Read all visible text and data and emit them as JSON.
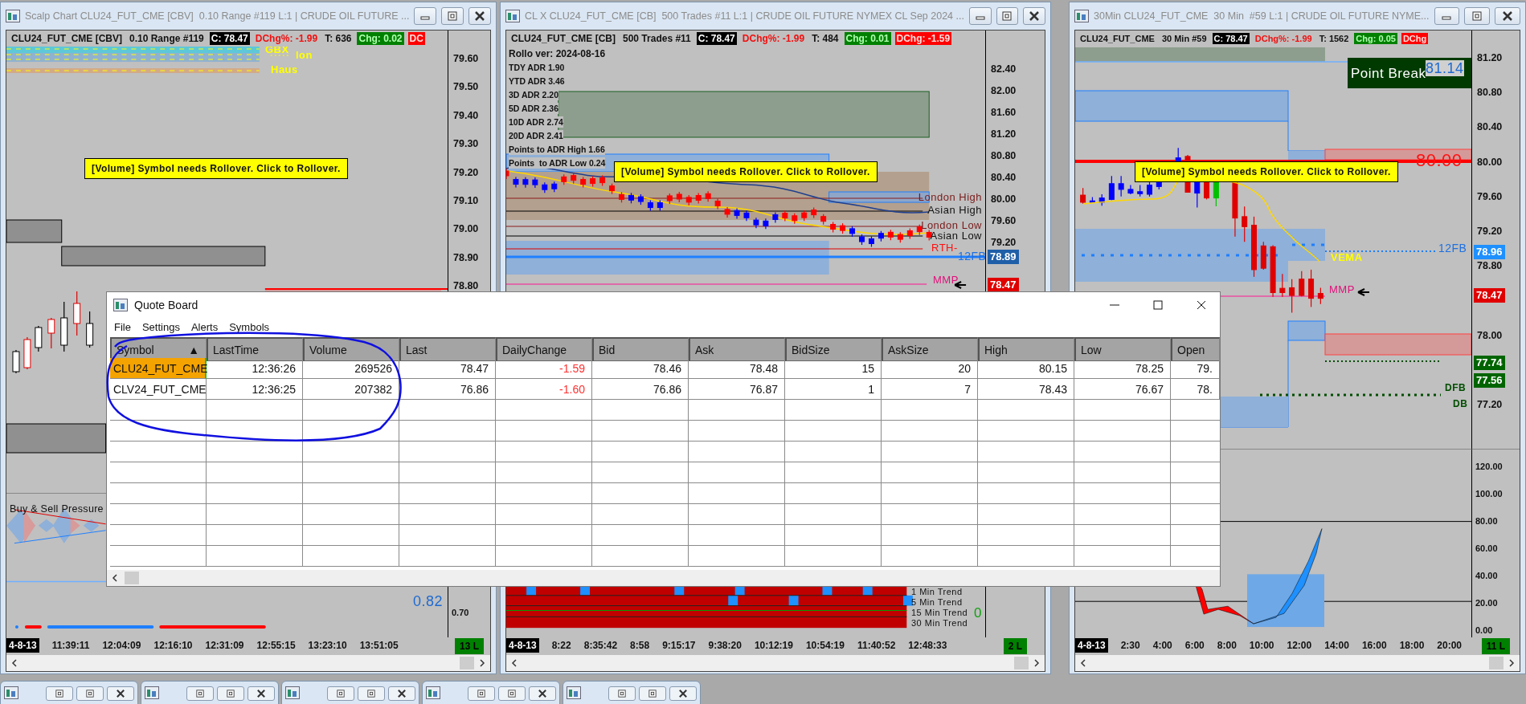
{
  "chart_windows": [
    {
      "kind": "range",
      "title": "Scalp Chart CLU24_FUT_CME [CBV]  0.10 Range #119 L:1 | CRUDE OIL FUTURE ...",
      "header": [
        {
          "kind": "plain",
          "text": "CLU24_FUT_CME [CBV]"
        },
        {
          "kind": "plain",
          "text": "0.10 Range #119"
        },
        {
          "kind": "close",
          "text": "C: 78.47"
        },
        {
          "kind": "down",
          "text": "DChg%: -1.99"
        },
        {
          "kind": "plain",
          "text": "T: 636"
        },
        {
          "kind": "up_box",
          "text": "Chg: 0.02"
        },
        {
          "kind": "down_box",
          "text": "DC"
        }
      ],
      "notice": "[Volume] Symbol needs Rollover. Click to Rollover.",
      "labels": [
        {
          "kind": "yellow",
          "text": "GBX"
        },
        {
          "kind": "yellow",
          "text": "lon"
        },
        {
          "kind": "yellow",
          "text": "Haus"
        }
      ],
      "price_ticks": [
        "79.60",
        "79.50",
        "79.40",
        "79.30",
        "79.20",
        "79.10",
        "79.00",
        "78.90",
        "78.80"
      ],
      "lower": {
        "labels": [
          {
            "kind": "title",
            "text": "Buy & Sell Pressure"
          },
          {
            "kind": "lightblue",
            "text": "0.82"
          }
        ],
        "ticks": [
          "0.70"
        ]
      },
      "time_start": "4-8-13",
      "time_ticks": [
        "11:39:11",
        "12:04:09",
        "12:16:10",
        "12:31:09",
        "12:55:15",
        "13:23:10",
        "13:51:05"
      ],
      "bar_count": "13 L"
    },
    {
      "kind": "trades",
      "title": "CL X CLU24_FUT_CME [CB]  500 Trades #11 L:1 | CRUDE OIL FUTURE NYMEX CL Sep 2024 ...",
      "header": [
        {
          "kind": "plain",
          "text": "CLU24_FUT_CME [CB]"
        },
        {
          "kind": "plain",
          "text": "500 Trades #11"
        },
        {
          "kind": "close",
          "text": "C: 78.47"
        },
        {
          "kind": "down",
          "text": "DChg%: -1.99"
        },
        {
          "kind": "plain",
          "text": "T: 484"
        },
        {
          "kind": "up_box",
          "text": "Chg: 0.01"
        },
        {
          "kind": "down_box",
          "text": "DChg: -1.59"
        }
      ],
      "notice": "[Volume] Symbol needs Rollover. Click to Rollover.",
      "stats": [
        "Rollo ver: 2024-08-16",
        "TDY ADR 1.90",
        "YTD ADR 3.46",
        "3D ADR 2.20",
        "5D ADR 2.36",
        "10D ADR 2.74",
        "20D ADR 2.41",
        "Points to ADR High 1.66",
        "Points  to ADR Low 0.24"
      ],
      "labels": [
        {
          "kind": "darkred",
          "text": "London High"
        },
        {
          "kind": "black",
          "text": "Asian High"
        },
        {
          "kind": "darkred",
          "text": "London Low"
        },
        {
          "kind": "black",
          "text": "Asian Low"
        },
        {
          "kind": "red",
          "text": "RTH-"
        },
        {
          "kind": "blue",
          "text": "12FB"
        },
        {
          "kind": "magenta",
          "text": "MMP"
        }
      ],
      "price_ticks": [
        "82.40",
        "82.00",
        "81.60",
        "81.20",
        "80.80",
        "80.40",
        "80.00",
        "79.60",
        "79.20"
      ],
      "price_badges": [
        {
          "text": "78.89",
          "color": "#1f5fa8"
        },
        {
          "text": "78.47",
          "color": "#e00000"
        }
      ],
      "lower": {
        "labels": [
          {
            "kind": "black",
            "text": "1 Min Trend"
          },
          {
            "kind": "black",
            "text": "5 Min Trend"
          },
          {
            "kind": "black",
            "text": "15 Min Trend"
          },
          {
            "kind": "black",
            "text": "30 Min Trend"
          },
          {
            "kind": "green",
            "text": "0"
          }
        ]
      },
      "time_start": "4-8-13",
      "time_ticks": [
        "8:22",
        "8:35:42",
        "8:58",
        "9:15:17",
        "9:38:20",
        "10:12:19",
        "10:54:19",
        "11:40:52",
        "12:48:33"
      ],
      "bar_count": "2 L"
    },
    {
      "kind": "time",
      "title": "30Min CLU24_FUT_CME  30 Min  #59 L:1 | CRUDE OIL FUTURE NYME...",
      "header": [
        {
          "kind": "plain",
          "text": "CLU24_FUT_CME"
        },
        {
          "kind": "plain",
          "text": "30 Min  #59"
        },
        {
          "kind": "close",
          "text": "C: 78.47"
        },
        {
          "kind": "down",
          "text": "DChg%: -1.99"
        },
        {
          "kind": "plain",
          "text": "T: 1562"
        },
        {
          "kind": "up_box",
          "text": "Chg: 0.05"
        },
        {
          "kind": "down_box",
          "text": "DChg"
        }
      ],
      "notice": "[Volume] Symbol needs Rollover. Click to Rollover.",
      "labels": [
        {
          "kind": "point_break",
          "text": "Point Break"
        },
        {
          "kind": "lightblue",
          "text": "81.14"
        },
        {
          "kind": "redlarge",
          "text": "80.00"
        },
        {
          "kind": "blue",
          "text": "12FB"
        },
        {
          "kind": "yellow",
          "text": "VEMA"
        },
        {
          "kind": "magenta",
          "text": "MMP"
        },
        {
          "kind": "darkgreen",
          "text": "DFB"
        },
        {
          "kind": "darkgreen",
          "text": "DB"
        }
      ],
      "price_ticks": [
        "81.20",
        "80.80",
        "80.40",
        "80.00",
        "79.60",
        "79.20",
        "78.80",
        "78.00",
        "77.20"
      ],
      "price_badges": [
        {
          "text": "78.96",
          "color": "#1e90ff"
        },
        {
          "text": "78.47",
          "color": "#e00000"
        },
        {
          "text": "77.74",
          "color": "#006400"
        },
        {
          "text": "77.56",
          "color": "#006400"
        }
      ],
      "lower": {
        "ticks": [
          "120.00",
          "100.00",
          "80.00",
          "60.00",
          "40.00",
          "20.00",
          "0.00"
        ]
      },
      "time_start": "4-8-13",
      "time_ticks": [
        "2:30",
        "4:00",
        "6:00",
        "8:00",
        "10:00",
        "12:00",
        "14:00",
        "16:00",
        "18:00",
        "20:00"
      ],
      "bar_count": "11 L"
    }
  ],
  "quote_board": {
    "title": "Quote Board",
    "menu": [
      "File",
      "Settings",
      "Alerts",
      "Symbols"
    ],
    "columns": [
      {
        "label": "Symbol",
        "kind": "symbol",
        "sort": "▲"
      },
      {
        "label": "LastTime",
        "kind": "number"
      },
      {
        "label": "Volume",
        "kind": "number"
      },
      {
        "label": "Last",
        "kind": "number"
      },
      {
        "label": "DailyChange",
        "kind": "change"
      },
      {
        "label": "Bid",
        "kind": "number"
      },
      {
        "label": "Ask",
        "kind": "number"
      },
      {
        "label": "BidSize",
        "kind": "number"
      },
      {
        "label": "AskSize",
        "kind": "number"
      },
      {
        "label": "High",
        "kind": "number"
      },
      {
        "label": "Low",
        "kind": "number"
      },
      {
        "label": "Open",
        "kind": "number"
      }
    ],
    "rows": [
      {
        "selected": true,
        "negative": true,
        "cells": [
          "CLU24_FUT_CME",
          "12:36:26",
          "269526",
          "78.47",
          "-1.59",
          "78.46",
          "78.48",
          "15",
          "20",
          "80.15",
          "78.25",
          "79."
        ]
      },
      {
        "selected": false,
        "negative": true,
        "cells": [
          "CLV24_FUT_CME",
          "12:36:25",
          "207382",
          "76.86",
          "-1.60",
          "76.86",
          "76.87",
          "1",
          "7",
          "78.43",
          "76.67",
          "78."
        ]
      }
    ]
  }
}
